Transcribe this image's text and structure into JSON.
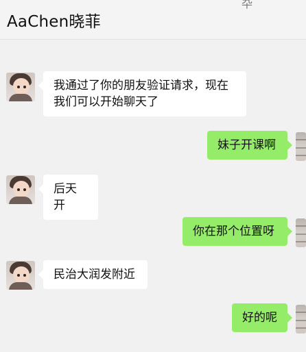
{
  "header": {
    "title": "AaChen晓菲",
    "corner_glyph": "卆"
  },
  "messages": [
    {
      "side": "left",
      "text_lines": [
        "我通过了你的朋友验证请求，现在",
        "我们可以开始聊天了"
      ]
    },
    {
      "side": "right",
      "text": "妹子开课啊"
    },
    {
      "side": "left",
      "text": "后天开"
    },
    {
      "side": "right",
      "text": "你在那个位置呀"
    },
    {
      "side": "left",
      "text": "民治大润发附近"
    },
    {
      "side": "right",
      "text": "好的呢"
    }
  ],
  "colors": {
    "background": "#f1f1f1",
    "incoming_bubble": "#ffffff",
    "outgoing_bubble": "#95ec69",
    "header_background": "#f4f4f4"
  },
  "icons": {
    "contact_avatar": "avatar-girl",
    "self_avatar": "avatar-self"
  }
}
